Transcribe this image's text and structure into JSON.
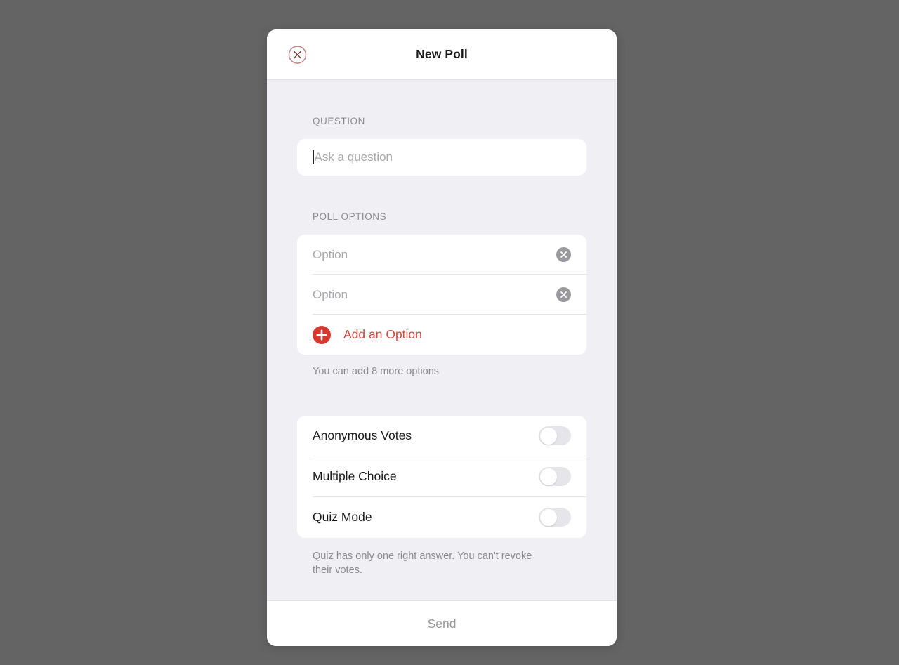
{
  "backdrop": {
    "color": "#646464"
  },
  "modal": {
    "background": "#efeff4",
    "header": {
      "title": "New Poll",
      "close_icon": "close-circle-icon"
    },
    "question": {
      "label": "QUESTION",
      "placeholder": "Ask a question",
      "value": ""
    },
    "poll_options": {
      "label": "POLL OPTIONS",
      "options": [
        {
          "placeholder": "Option",
          "value": "",
          "clear_icon": "clear-circle-icon"
        },
        {
          "placeholder": "Option",
          "value": "",
          "clear_icon": "clear-circle-icon"
        }
      ],
      "add_option": {
        "label": "Add an Option",
        "icon": "plus-circle-icon",
        "color": "#d5483f"
      },
      "hint": "You can add 8 more options"
    },
    "settings": {
      "toggles": [
        {
          "label": "Anonymous Votes",
          "on": false
        },
        {
          "label": "Multiple Choice",
          "on": false
        },
        {
          "label": "Quiz Mode",
          "on": false
        }
      ],
      "hint": "Quiz has only one right answer. You can't revoke their votes."
    },
    "footer": {
      "send_label": "Send",
      "send_enabled": false
    }
  }
}
